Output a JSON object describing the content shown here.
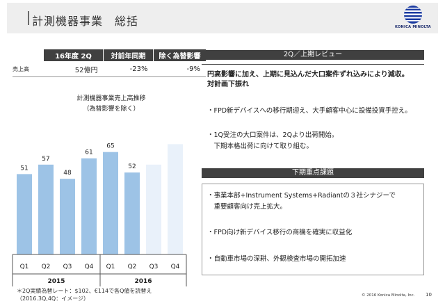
{
  "header": {
    "title": "計測機器事業　総括",
    "logo_text": "KONICA MINOLTA"
  },
  "summary_table": {
    "headers": [
      "16年度 2Q",
      "対前年同期",
      "除く為替影響"
    ],
    "row_label": "売上高",
    "values": [
      "52億円",
      "-23%",
      "-9%"
    ]
  },
  "chart_title": {
    "line1": "計測機器事業売上高推移",
    "line2": "（為替影響を除く）"
  },
  "chart_data": {
    "type": "bar",
    "categories": [
      "Q1",
      "Q2",
      "Q3",
      "Q4",
      "Q1",
      "Q2",
      "Q3",
      "Q4"
    ],
    "groups": [
      "2015",
      "2015",
      "2015",
      "2015",
      "2016",
      "2016",
      "2016",
      "2016"
    ],
    "group_labels": [
      "2015",
      "2016"
    ],
    "values": [
      51,
      57,
      48,
      61,
      65,
      52,
      null,
      null
    ],
    "data_labels": [
      "51",
      "57",
      "48",
      "61",
      "65",
      "52",
      "",
      ""
    ],
    "projection_values": [
      null,
      null,
      null,
      null,
      null,
      null,
      57,
      70
    ],
    "colors": {
      "bar": "#9dc3e6",
      "projection": "#e9f1fa"
    },
    "title": "計測機器事業売上高推移",
    "subtitle": "（為替影響を除く）",
    "ylim": [
      0,
      75
    ]
  },
  "review": {
    "header": "2Q／上期レビュー",
    "lead": [
      "円高影響に加え、上期に見込んだ大口案件ずれ込みにより減収。",
      "対計画下振れ"
    ],
    "bullets": [
      [
        "・FPD新デバイスへの移行期迎え、大手顧客中心に設備投資手控え。"
      ],
      [
        "・1Q受注の大口案件は、2Qより出荷開始。",
        "　下期本格出荷に向けて取り組む。"
      ]
    ]
  },
  "issues": {
    "header": "下期重点課題",
    "bullets": [
      [
        "・事業本部+Instrument Systems+Radiantの３社シナジーで",
        "　重要顧客向け売上拡大。"
      ],
      [
        "・FPD向け新デバイス移行の商機を確実に収益化"
      ],
      [
        "・自動車市場の深耕、外観検査市場の開拓加速"
      ]
    ]
  },
  "footnote": [
    "＊2Q実績為替レート：$102、€114で各Q値を読替え",
    "（2016.3Q,4Q：イメージ）"
  ],
  "footer": {
    "copyright": "© 2016 Konica Minolta, Inc.",
    "page": "10"
  }
}
